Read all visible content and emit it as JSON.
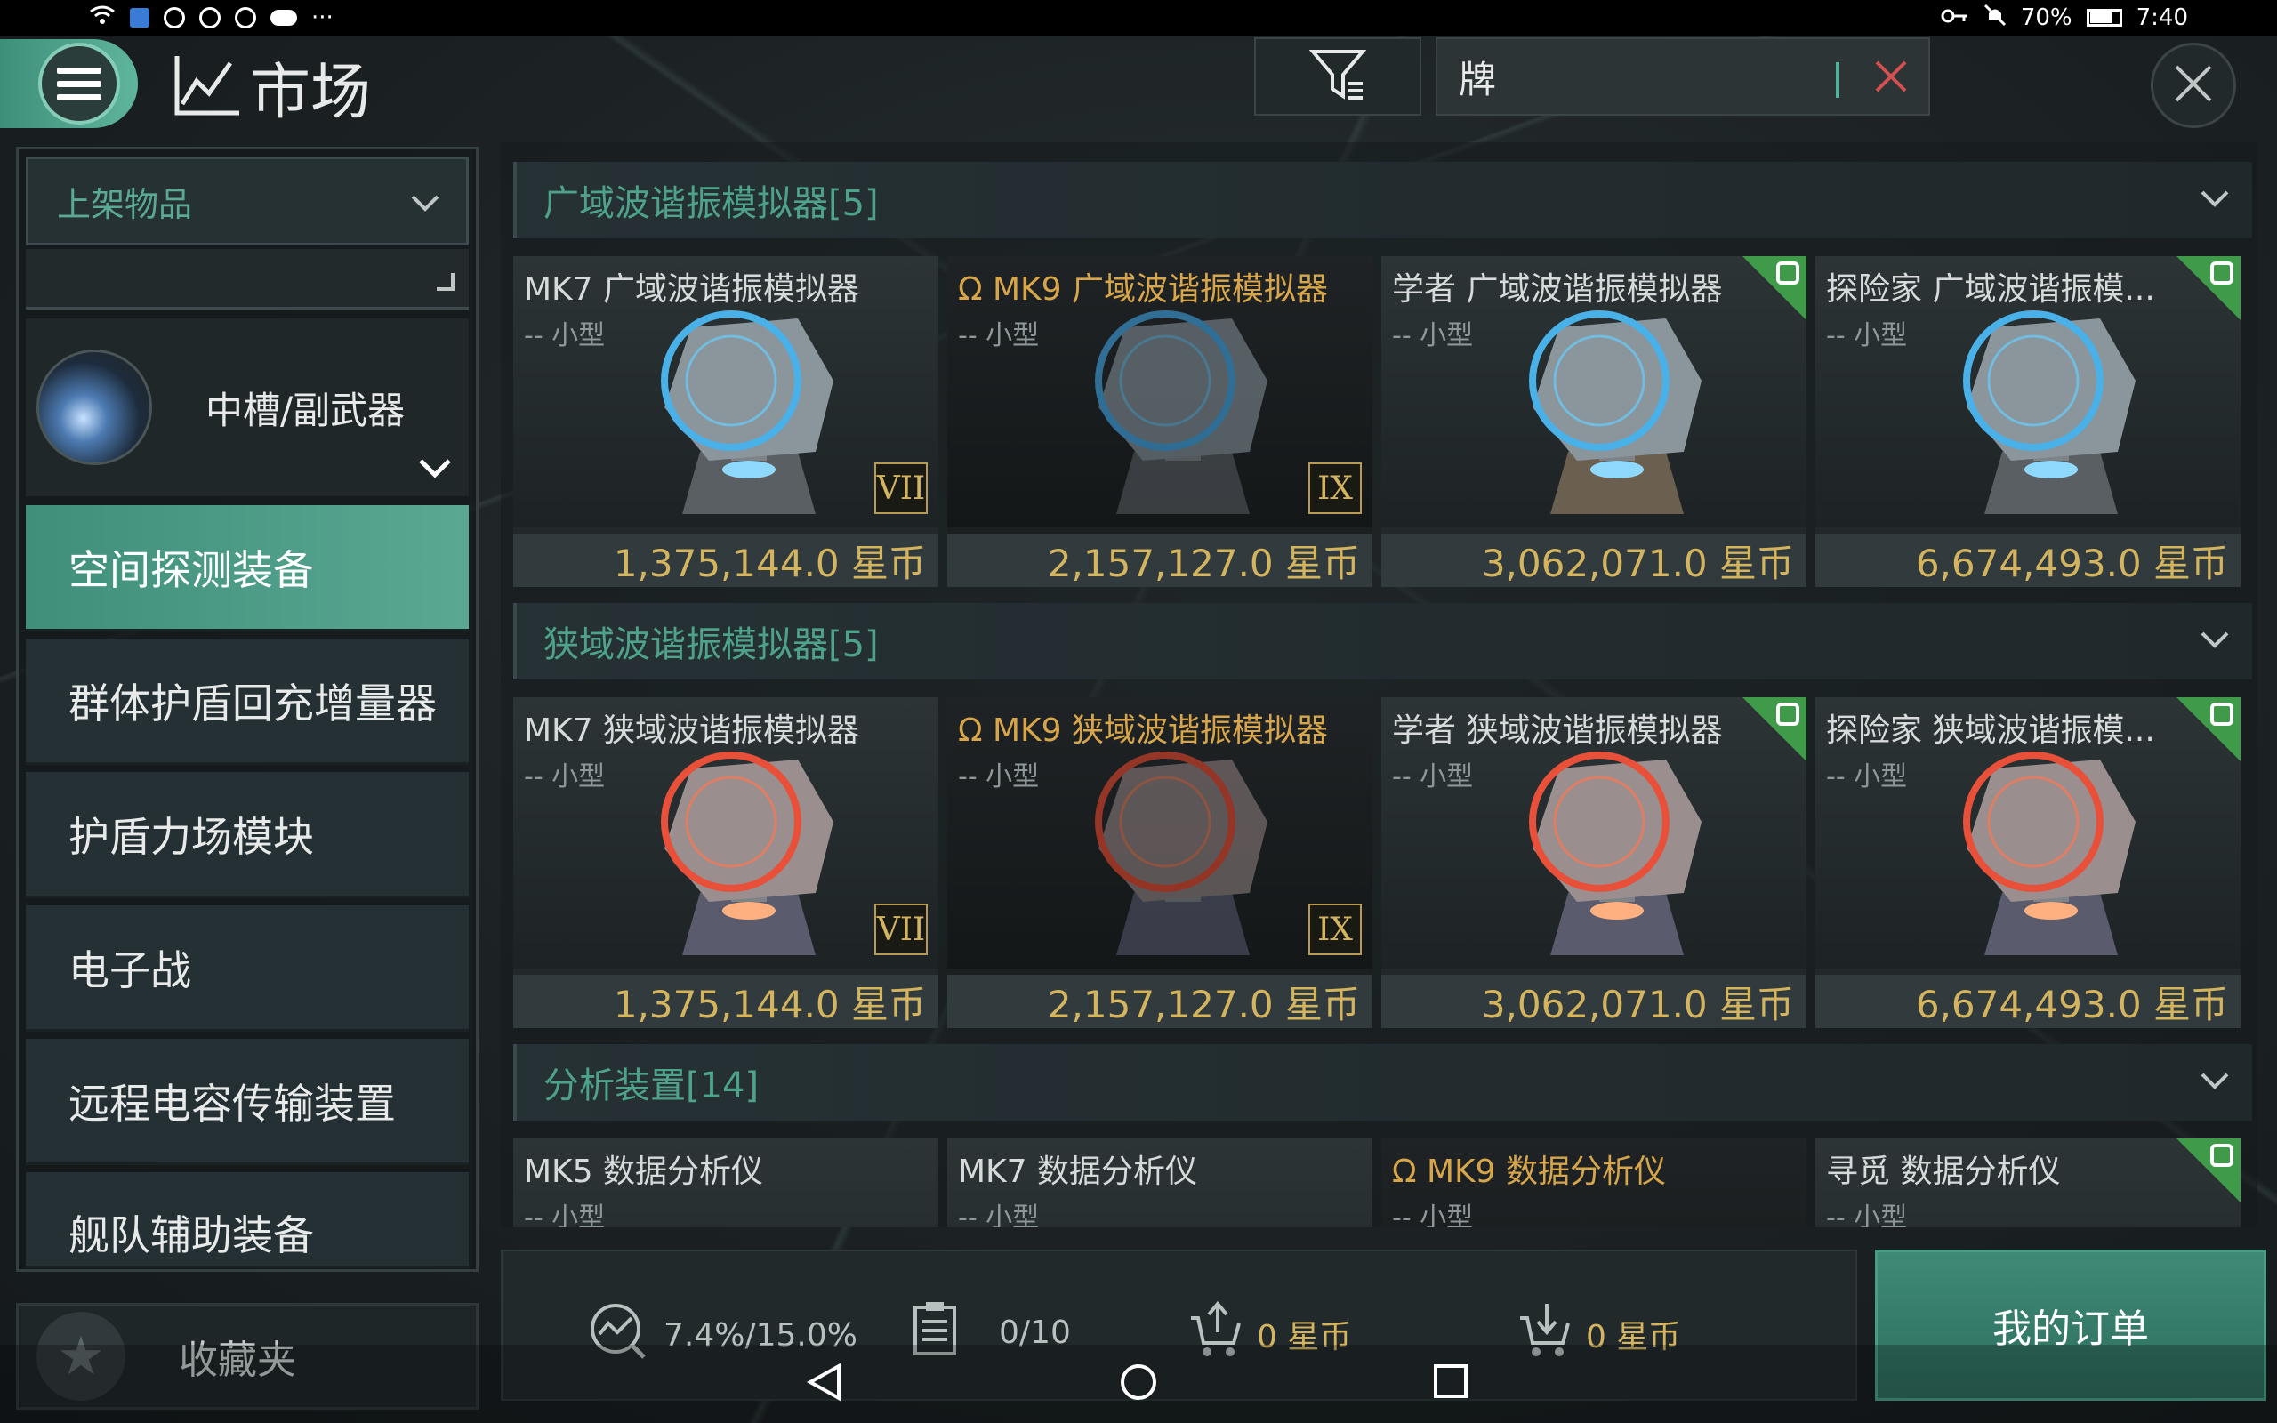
{
  "status_bar": {
    "left_icons": [
      "wifi-icon",
      "network-icon",
      "notification-icon",
      "notification-icon",
      "notification-icon",
      "cloud-icon",
      "more-icon"
    ],
    "more": "···",
    "battery": "70%",
    "time": "7:40"
  },
  "header": {
    "title": "市场",
    "search_value": "牌"
  },
  "sidebar": {
    "dropdown_label": "上架物品",
    "category_label": "中槽/副武器",
    "sub_items": [
      {
        "label": "空间探测装备",
        "active": true
      },
      {
        "label": "群体护盾回充增量器",
        "active": false
      },
      {
        "label": "护盾力场模块",
        "active": false
      },
      {
        "label": "电子战",
        "active": false
      },
      {
        "label": "远程电容传输装置",
        "active": false
      },
      {
        "label": "舰队辅助装备",
        "active": false
      }
    ],
    "favorites_label": "收藏夹"
  },
  "sections": [
    {
      "title": "广域波谐振模拟器[5]",
      "items": [
        {
          "name": "MK7 广域波谐振模拟器",
          "sub": "-- 小型",
          "tier": "VII",
          "omega": false,
          "corner": false,
          "price": "1,375,144.0 星币",
          "color": "blue"
        },
        {
          "name": "Ω MK9 广域波谐振模拟器",
          "sub": "-- 小型",
          "tier": "IX",
          "omega": true,
          "corner": false,
          "price": "2,157,127.0 星币",
          "color": "blue"
        },
        {
          "name": "学者 广域波谐振模拟器",
          "sub": "-- 小型",
          "tier": "",
          "omega": false,
          "corner": true,
          "price": "3,062,071.0 星币",
          "color": "blue"
        },
        {
          "name": "探险家 广域波谐振模...",
          "sub": "-- 小型",
          "tier": "",
          "omega": false,
          "corner": true,
          "price": "6,674,493.0 星币",
          "color": "blue"
        }
      ]
    },
    {
      "title": "狭域波谐振模拟器[5]",
      "items": [
        {
          "name": "MK7 狭域波谐振模拟器",
          "sub": "-- 小型",
          "tier": "VII",
          "omega": false,
          "corner": false,
          "price": "1,375,144.0 星币",
          "color": "red"
        },
        {
          "name": "Ω MK9 狭域波谐振模拟器",
          "sub": "-- 小型",
          "tier": "IX",
          "omega": true,
          "corner": false,
          "price": "2,157,127.0 星币",
          "color": "red"
        },
        {
          "name": "学者 狭域波谐振模拟器",
          "sub": "-- 小型",
          "tier": "",
          "omega": false,
          "corner": true,
          "price": "3,062,071.0 星币",
          "color": "red"
        },
        {
          "name": "探险家 狭域波谐振模...",
          "sub": "-- 小型",
          "tier": "",
          "omega": false,
          "corner": true,
          "price": "6,674,493.0 星币",
          "color": "red"
        }
      ]
    },
    {
      "title": "分析装置[14]",
      "items": [
        {
          "name": "MK5 数据分析仪",
          "sub": "-- 小型",
          "tier": "",
          "omega": false,
          "corner": false,
          "price": "",
          "color": "red"
        },
        {
          "name": "MK7 数据分析仪",
          "sub": "-- 小型",
          "tier": "",
          "omega": false,
          "corner": false,
          "price": "",
          "color": "red"
        },
        {
          "name": "Ω MK9 数据分析仪",
          "sub": "-- 小型",
          "tier": "",
          "omega": true,
          "corner": false,
          "price": "",
          "color": "red"
        },
        {
          "name": "寻觅 数据分析仪",
          "sub": "-- 小型",
          "tier": "",
          "omega": false,
          "corner": true,
          "price": "",
          "color": "red"
        }
      ]
    }
  ],
  "bottom_bar": {
    "tax_rate": "7.4%/15.0%",
    "orders_count": "0/10",
    "sell_amount": "0 星币",
    "buy_amount": "0 星币",
    "my_orders_label": "我的订单"
  },
  "colors": {
    "accent": "#4ea28c",
    "gold": "#d4b45f",
    "omega_gold": "#d7a64b",
    "corner_green": "#3f9a4a"
  }
}
